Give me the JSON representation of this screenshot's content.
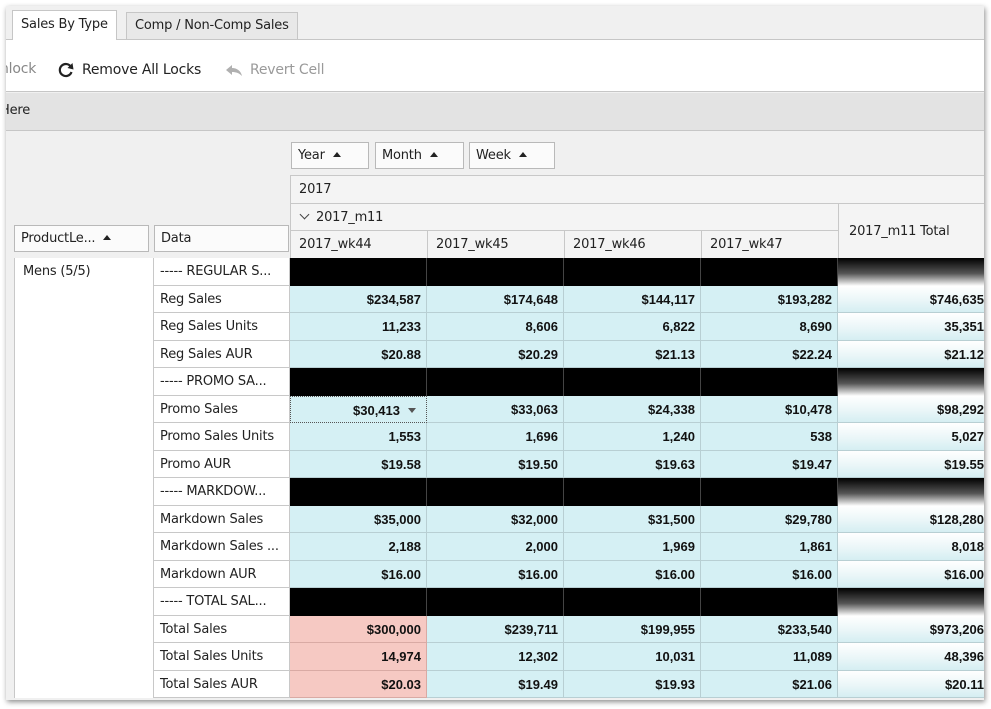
{
  "tabs": [
    {
      "label": "Sales By Type",
      "active": true
    },
    {
      "label": "Comp / Non-Comp Sales",
      "active": false
    }
  ],
  "toolbar": {
    "unlock_label": "nlock",
    "remove_locks_label": "Remove All Locks",
    "revert_label": "Revert Cell"
  },
  "filterbar": {
    "text": "Here"
  },
  "fields": {
    "year": "Year",
    "month": "Month",
    "week": "Week",
    "product": "ProductLe...",
    "data": "Data"
  },
  "columns": {
    "year": "2017",
    "month": "2017_m11",
    "weeks": [
      "2017_wk44",
      "2017_wk45",
      "2017_wk46",
      "2017_wk47"
    ],
    "month_total": "2017_m11 Total"
  },
  "product": "Mens (5/5)",
  "rows": [
    {
      "label": "----- REGULAR S...",
      "separator": true,
      "values": [
        "",
        "",
        "",
        "",
        ""
      ]
    },
    {
      "label": "Reg Sales",
      "values": [
        "$234,587",
        "$174,648",
        "$144,117",
        "$193,282",
        "$746,635"
      ]
    },
    {
      "label": "Reg Sales Units",
      "values": [
        "11,233",
        "8,606",
        "6,822",
        "8,690",
        "35,351"
      ]
    },
    {
      "label": "Reg Sales AUR",
      "values": [
        "$20.88",
        "$20.29",
        "$21.13",
        "$22.24",
        "$21.12"
      ]
    },
    {
      "label": "----- PROMO SA...",
      "separator": true,
      "values": [
        "",
        "",
        "",
        "",
        ""
      ]
    },
    {
      "label": "Promo Sales",
      "values": [
        "$30,413",
        "$33,063",
        "$24,338",
        "$10,478",
        "$98,292"
      ]
    },
    {
      "label": "Promo Sales Units",
      "values": [
        "1,553",
        "1,696",
        "1,240",
        "538",
        "5,027"
      ]
    },
    {
      "label": "Promo AUR",
      "values": [
        "$19.58",
        "$19.50",
        "$19.63",
        "$19.47",
        "$19.55"
      ]
    },
    {
      "label": "----- MARKDOW...",
      "separator": true,
      "values": [
        "",
        "",
        "",
        "",
        ""
      ]
    },
    {
      "label": "Markdown Sales",
      "values": [
        "$35,000",
        "$32,000",
        "$31,500",
        "$29,780",
        "$128,280"
      ]
    },
    {
      "label": "Markdown Sales ...",
      "values": [
        "2,188",
        "2,000",
        "1,969",
        "1,861",
        "8,018"
      ]
    },
    {
      "label": "Markdown AUR",
      "values": [
        "$16.00",
        "$16.00",
        "$16.00",
        "$16.00",
        "$16.00"
      ]
    },
    {
      "label": "----- TOTAL SAL...",
      "separator": true,
      "values": [
        "",
        "",
        "",
        "",
        ""
      ]
    },
    {
      "label": "Total Sales",
      "values": [
        "$300,000",
        "$239,711",
        "$199,955",
        "$233,540",
        "$973,206"
      ]
    },
    {
      "label": "Total Sales Units",
      "values": [
        "14,974",
        "12,302",
        "10,031",
        "11,089",
        "48,396"
      ]
    },
    {
      "label": "Total Sales AUR",
      "values": [
        "$20.03",
        "$19.49",
        "$19.93",
        "$21.06",
        "$20.11"
      ]
    }
  ],
  "colors": {
    "value_cell": "#d5f0f4",
    "highlight_cell": "#f6c9c3",
    "separator": "#000000"
  },
  "icons": {
    "remove_locks": "refresh-icon",
    "revert": "undo-arrow-icon"
  }
}
